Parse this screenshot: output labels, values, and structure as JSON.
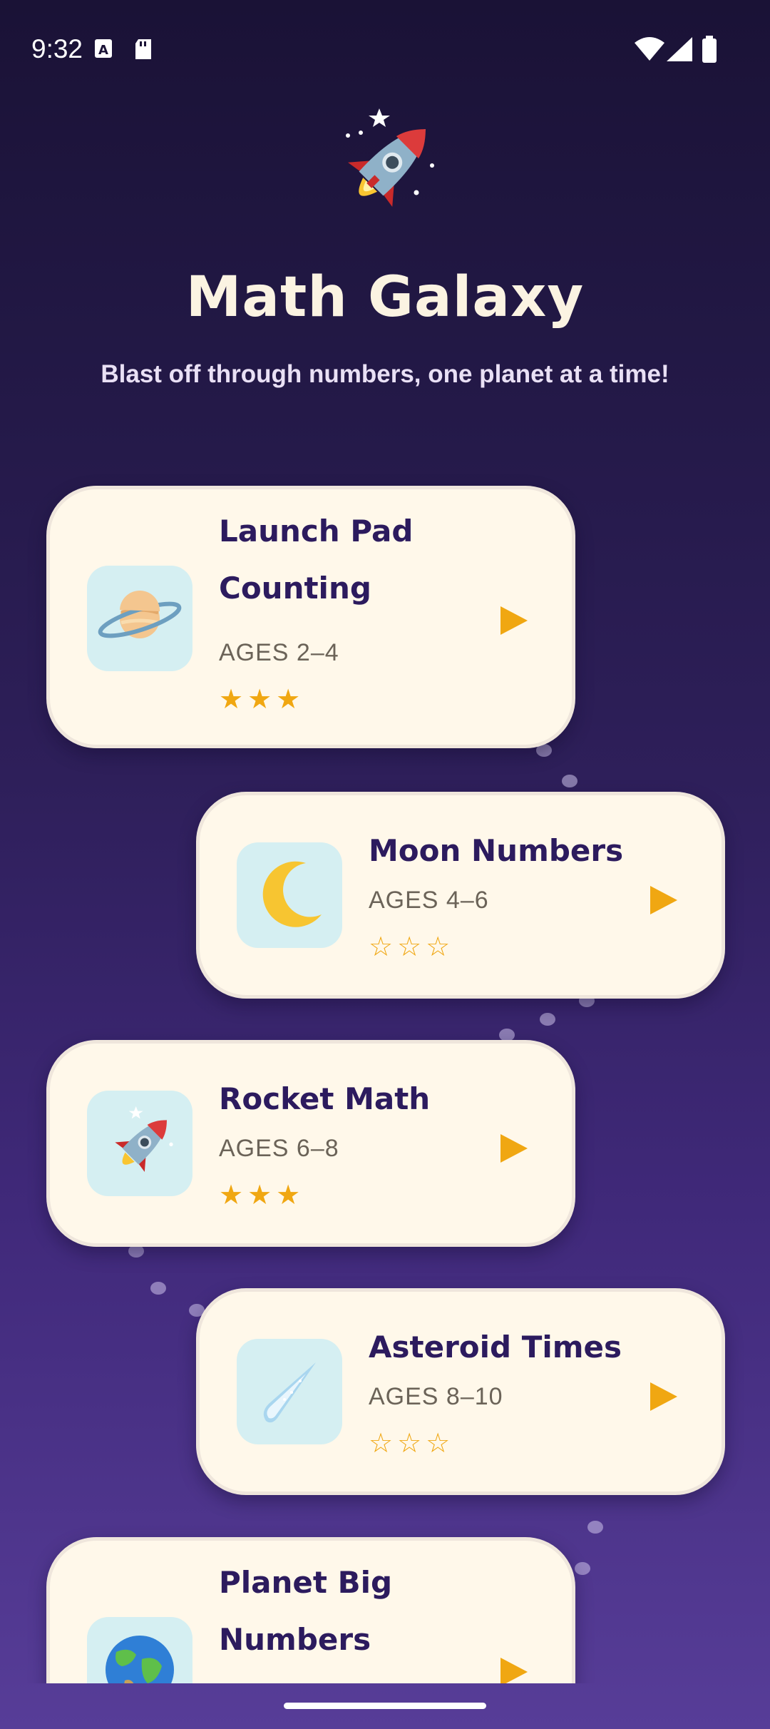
{
  "status_bar": {
    "time": "9:32"
  },
  "header": {
    "title": "Math Galaxy",
    "subtitle": "Blast off through numbers, one planet at a time!"
  },
  "levels": [
    {
      "title_line1": "Launch Pad",
      "title_line2": "Counting",
      "ages": "AGES 2–4",
      "stars": "★★★",
      "stars_earned": 3,
      "icon": "ringed-planet-icon"
    },
    {
      "title_line1": "Moon Numbers",
      "ages": "AGES 4–6",
      "stars": "☆☆☆",
      "stars_earned": 0,
      "icon": "crescent-moon-icon"
    },
    {
      "title_line1": "Rocket Math",
      "ages": "AGES 6–8",
      "stars": "★★★",
      "stars_earned": 3,
      "icon": "rocket-icon"
    },
    {
      "title_line1": "Asteroid Times",
      "ages": "AGES 8–10",
      "stars": "☆☆☆",
      "stars_earned": 0,
      "icon": "comet-icon"
    },
    {
      "title_line1": "Planet Big",
      "title_line2": "Numbers",
      "icon": "globe-icon"
    }
  ],
  "colors": {
    "card_bg": "#fff8ea",
    "accent_star": "#f0a712",
    "title_text": "#2c1b5e",
    "icon_tile": "#d5eff2"
  }
}
